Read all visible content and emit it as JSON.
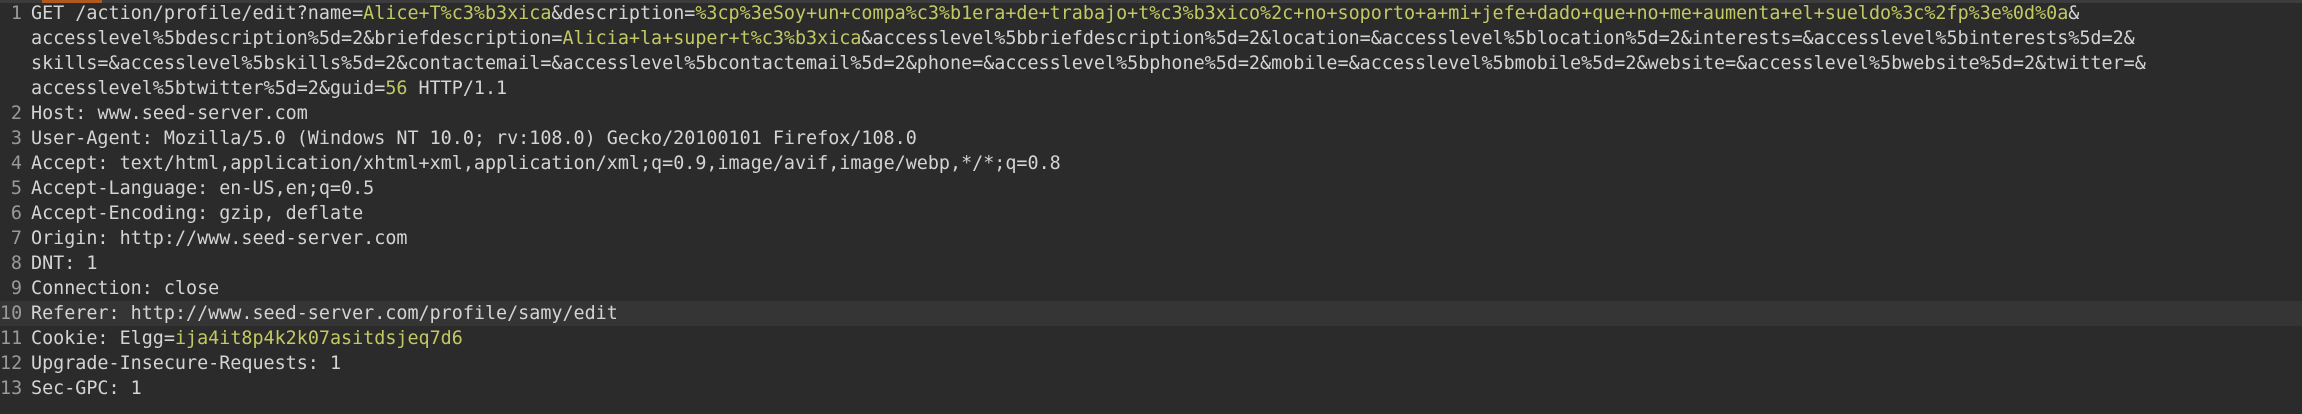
{
  "request_line": {
    "prefix": "GET /action/profile/edit?name=",
    "name_value": "Alice+T%c3%b3xica",
    "desc_key": "&description=",
    "desc_value": "%3cp%3eSoy+un+compa%c3%b1era+de+trabajo+t%c3%b3xico%2c+no+soporto+a+mi+jefe+dado+que+no+me+aumenta+el+sueldo%3c%2fp%3e%0d%0a",
    "trail1": "&",
    "wrap2_a": "accesslevel%5bdescription%5d=2&briefdescription=",
    "brief_value": "Alicia+la+super+t%c3%b3xica",
    "wrap2_b": "&accesslevel%5bbriefdescription%5d=2&location=&accesslevel%5blocation%5d=2&interests=&accesslevel%5binterests%5d=2&",
    "wrap3": "skills=&accesslevel%5bskills%5d=2&contactemail=&accesslevel%5bcontactemail%5d=2&phone=&accesslevel%5bphone%5d=2&mobile=&accesslevel%5bmobile%5d=2&website=&accesslevel%5bwebsite%5d=2&twitter=&",
    "wrap4_a": "accesslevel%5btwitter%5d=2&guid=",
    "guid_value": "56",
    "wrap4_b": " HTTP/1.1"
  },
  "line_numbers": [
    "1",
    "2",
    "3",
    "4",
    "5",
    "6",
    "7",
    "8",
    "9",
    "10",
    "11",
    "12",
    "13"
  ],
  "headers": [
    {
      "name": "Host:",
      "value": " www.seed-server.com"
    },
    {
      "name": "User-Agent:",
      "value": " Mozilla/5.0 (Windows NT 10.0; rv:108.0) Gecko/20100101 Firefox/108.0"
    },
    {
      "name": "Accept:",
      "value": " text/html,application/xhtml+xml,application/xml;q=0.9,image/avif,image/webp,*/*;q=0.8"
    },
    {
      "name": "Accept-Language:",
      "value": " en-US,en;q=0.5"
    },
    {
      "name": "Accept-Encoding:",
      "value": " gzip, deflate"
    },
    {
      "name": "Origin:",
      "value": " http://www.seed-server.com"
    },
    {
      "name": "DNT:",
      "value": " 1"
    },
    {
      "name": "Connection:",
      "value": " close"
    },
    {
      "name": "Referer:",
      "value": " http://www.seed-server.com/profile/samy/edit"
    },
    {
      "name": "Cookie:",
      "value": " Elgg="
    },
    {
      "name": "Upgrade-Insecure-Requests:",
      "value": " 1"
    },
    {
      "name": "Sec-GPC:",
      "value": " 1"
    }
  ],
  "cookie_value": "ija4it8p4k2k07asitdsjeq7d6",
  "colors": {
    "background": "#2b2b2b",
    "text": "#d4d4d4",
    "param_value": "#c3c962",
    "line_number": "#9a9a9a",
    "highlight_row": "#353535",
    "accent": "#b05a1e"
  }
}
